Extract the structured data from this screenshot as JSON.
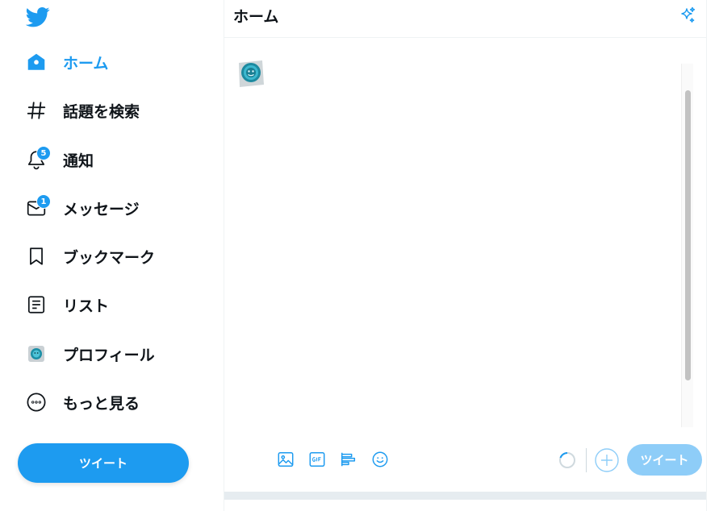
{
  "colors": {
    "accent": "#1d9bf0",
    "accent_disabled": "#8ecdf8",
    "text": "#0f1419"
  },
  "sidebar": {
    "logo_icon": "twitter-bird-icon",
    "items": [
      {
        "label": "ホーム",
        "icon": "home-icon",
        "active": true
      },
      {
        "label": "話題を検索",
        "icon": "hashtag-icon"
      },
      {
        "label": "通知",
        "icon": "bell-icon",
        "badge": "5"
      },
      {
        "label": "メッセージ",
        "icon": "envelope-icon",
        "badge": "1"
      },
      {
        "label": "ブックマーク",
        "icon": "bookmark-icon"
      },
      {
        "label": "リスト",
        "icon": "list-icon"
      },
      {
        "label": "プロフィール",
        "icon": "avatar-icon"
      },
      {
        "label": "もっと見る",
        "icon": "more-circle-icon"
      }
    ],
    "tweet_button": "ツイート"
  },
  "main": {
    "title": "ホーム",
    "sparkle_icon": "sparkle-icon",
    "compose": {
      "avatar_icon": "avatar-icon",
      "toolbar_icons": [
        "image-icon",
        "gif-icon",
        "poll-icon",
        "emoji-icon"
      ],
      "submit_label": "ツイート"
    }
  }
}
